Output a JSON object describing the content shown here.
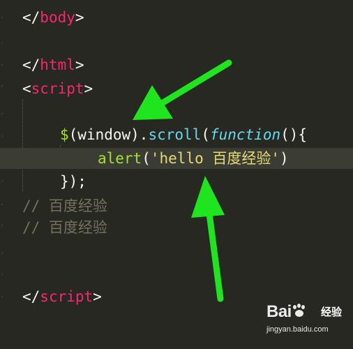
{
  "code_lines": {
    "l1": {
      "open": "</",
      "tag": "body",
      "close": ">"
    },
    "l3": {
      "open": "</",
      "tag": "html",
      "close": ">"
    },
    "l4": {
      "open": "<",
      "tag": "script",
      "close": ">"
    },
    "l6": {
      "dollar": "$",
      "paren1": "(window).",
      "method": "scroll",
      "paren2": "(",
      "keyword": "function",
      "rest": "(){"
    },
    "l7": {
      "fn": "alert",
      "open": "(",
      "str": "'hello 百度经验'",
      "close": ")"
    },
    "l8": {
      "text": "});"
    },
    "l9": {
      "comment": "// 百度经验"
    },
    "l10": {
      "comment": "// 百度经验"
    },
    "l13": {
      "open": "</",
      "tag": "script",
      "close": ">"
    }
  },
  "annotations": {
    "arrow_color": "#1fe51f",
    "arrow_count": 2
  },
  "watermark": {
    "brand": "Bai",
    "brand_suffix": "经验",
    "url": "jingyan.baidu.com"
  },
  "colors": {
    "background": "#272822",
    "tag": "#f92672",
    "method": "#66d9ef",
    "function_name": "#a6e22e",
    "string": "#e6db74",
    "comment": "#75715e"
  }
}
